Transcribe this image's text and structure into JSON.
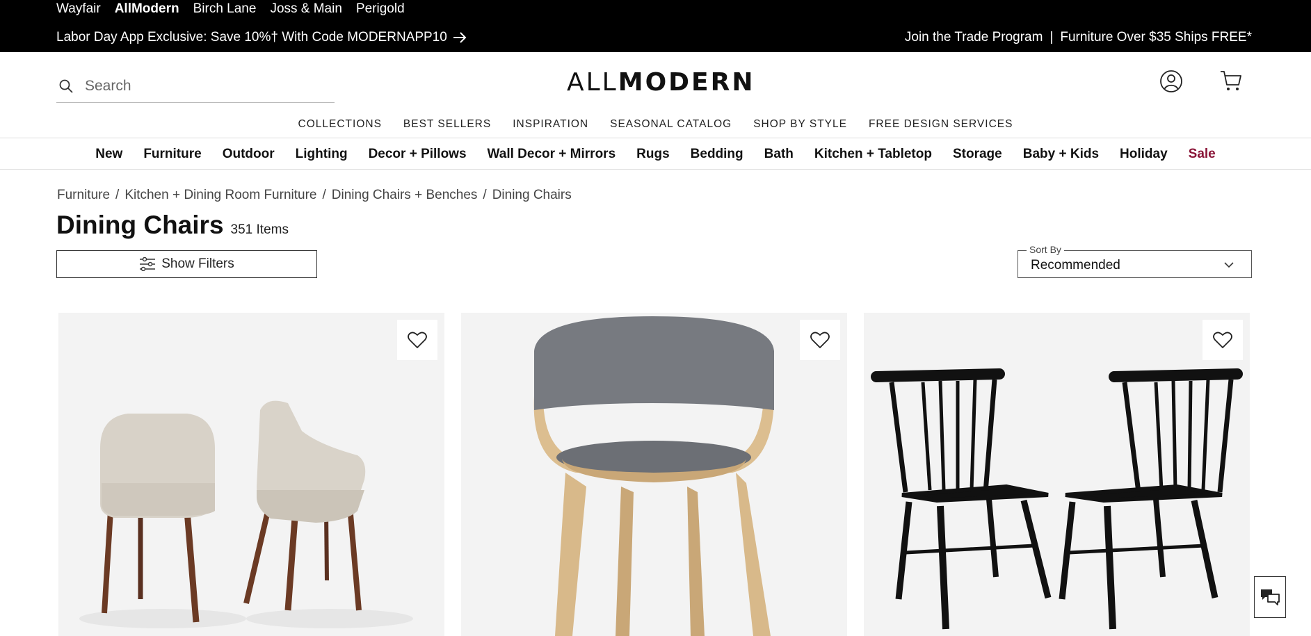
{
  "topbar": {
    "brands": [
      "Wayfair",
      "AllModern",
      "Birch Lane",
      "Joss & Main",
      "Perigold"
    ],
    "active_brand": "AllModern",
    "promo": "Labor Day App Exclusive: Save 10%† With Code MODERNAPP10",
    "trade_link": "Join the Trade Program",
    "trade_sep": "|",
    "shipping": "Furniture Over $35 Ships FREE*"
  },
  "header": {
    "search_placeholder": "Search",
    "logo_thin": "ALL",
    "logo_bold": "MODERN"
  },
  "subnav": [
    "COLLECTIONS",
    "BEST SELLERS",
    "INSPIRATION",
    "SEASONAL CATALOG",
    "SHOP BY STYLE",
    "FREE DESIGN SERVICES"
  ],
  "catnav": [
    "New",
    "Furniture",
    "Outdoor",
    "Lighting",
    "Decor + Pillows",
    "Wall Decor + Mirrors",
    "Rugs",
    "Bedding",
    "Bath",
    "Kitchen + Tabletop",
    "Storage",
    "Baby + Kids",
    "Holiday",
    "Sale"
  ],
  "breadcrumb": [
    "Furniture",
    "Kitchen + Dining Room Furniture",
    "Dining Chairs + Benches",
    "Dining Chairs"
  ],
  "breadcrumb_sep": "/",
  "page": {
    "title": "Dining Chairs",
    "count": "351 Items"
  },
  "controls": {
    "filters_label": "Show Filters",
    "sort_label": "Sort By",
    "sort_value": "Recommended"
  },
  "colors": {
    "sale": "#8a1538",
    "topbar_bg": "#000000",
    "card_bg": "#f5f5f5"
  },
  "icons": {
    "search": "search-icon",
    "account": "account-icon",
    "cart": "cart-icon",
    "arrow": "arrow-right-icon",
    "filters": "sliders-icon",
    "chevron": "chevron-down-icon",
    "heart": "heart-icon",
    "chat": "chat-icon"
  }
}
